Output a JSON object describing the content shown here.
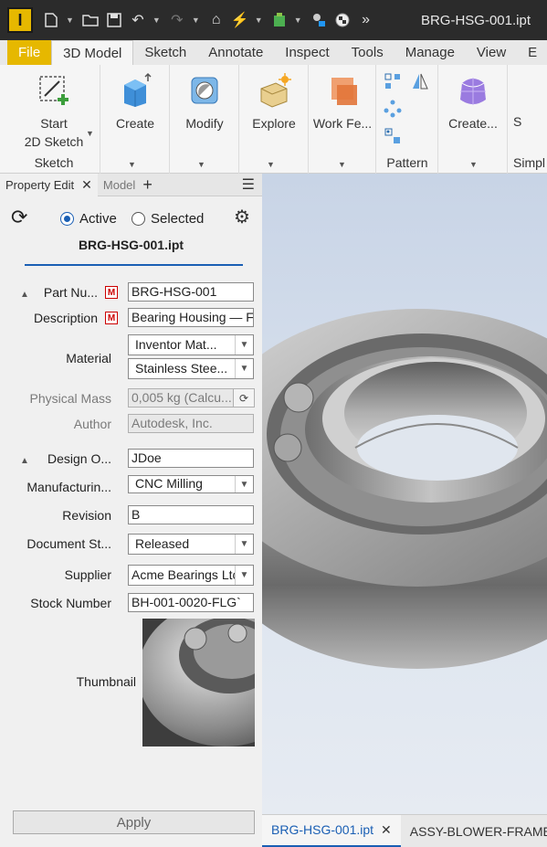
{
  "app": {
    "logo_letter": "I",
    "window_title": "BRG-HSG-001.ipt"
  },
  "ribbon_tabs": [
    "File",
    "3D Model",
    "Sketch",
    "Annotate",
    "Inspect",
    "Tools",
    "Manage",
    "View",
    "E"
  ],
  "ribbon": {
    "start_sketch": "Start",
    "start_sketch_2": "2D Sketch",
    "sketch_group": "Sketch",
    "create": "Create",
    "modify": "Modify",
    "explore": "Explore",
    "work_features": "Work Fe...",
    "pattern_group": "Pattern",
    "create_freeform": "Create...",
    "s_partial": "S",
    "simplify_partial": "Simpl"
  },
  "dock": {
    "tab_property": "Property Edit",
    "tab_model": "Model",
    "radio_active": "Active",
    "radio_selected": "Selected",
    "file_title": "BRG-HSG-001.ipt",
    "badge": "M"
  },
  "properties": {
    "part_number_label": "Part Nu...",
    "part_number_value": "BRG-HSG-001",
    "description_label": "Description",
    "description_value": "Bearing Housing — Fl",
    "material_label": "Material",
    "material_library": "Inventor Mat...",
    "material_value": "Stainless Stee...",
    "mass_label": "Physical Mass",
    "mass_value": "0,005 kg (Calcu...",
    "author_label": "Author",
    "author_value": "Autodesk, Inc.",
    "design_owner_label": "Design O...",
    "design_owner_value": "JDoe",
    "manufacturing_label": "Manufacturin...",
    "manufacturing_value": "CNC Milling",
    "revision_label": "Revision",
    "revision_value": "B",
    "doc_status_label": "Document St...",
    "doc_status_value": "Released",
    "supplier_label": "Supplier",
    "supplier_value": "Acme Bearings Ltc",
    "stock_label": "Stock Number",
    "stock_value": "BH-001-0020-FLG`",
    "thumbnail_label": "Thumbnail",
    "apply": "Apply"
  },
  "doc_tabs": {
    "active": "BRG-HSG-001.ipt",
    "other": "ASSY-BLOWER-FRAME"
  },
  "colors": {
    "file_tab": "#e6b800",
    "accent_blue": "#1a5fb4",
    "required_red": "#cc0000"
  }
}
